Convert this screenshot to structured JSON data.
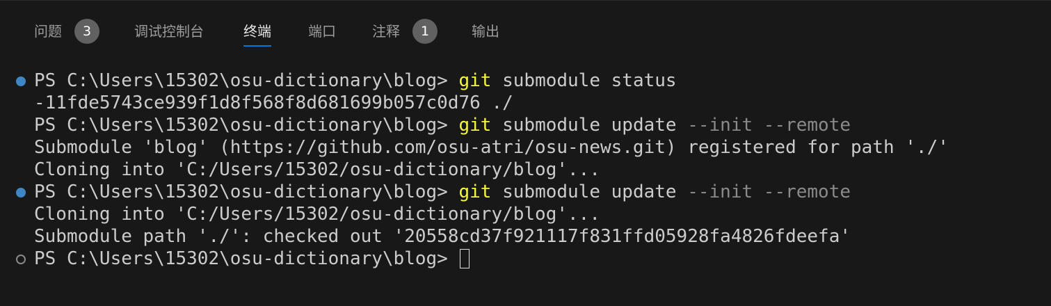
{
  "panel_tabs": [
    {
      "label": "问题",
      "badge": "3"
    },
    {
      "label": "调试控制台"
    },
    {
      "label": "终端",
      "active": true
    },
    {
      "label": "端口"
    },
    {
      "label": "注释",
      "badge": "1"
    },
    {
      "label": "输出"
    }
  ],
  "terminal": {
    "lines": [
      {
        "prompt": "PS C:\\Users\\15302\\osu-dictionary\\blog> ",
        "cmd": "git",
        "args": " submodule status",
        "flags": ""
      },
      {
        "text": "-11fde5743ce939f1d8f568f8d681699b057c0d76 ./"
      },
      {
        "prompt": "PS C:\\Users\\15302\\osu-dictionary\\blog> ",
        "cmd": "git",
        "args": " submodule update ",
        "flags": "--init --remote"
      },
      {
        "text": "Submodule 'blog' (https://github.com/osu-atri/osu-news.git) registered for path './'"
      },
      {
        "text": "Cloning into 'C:/Users/15302/osu-dictionary/blog'..."
      },
      {
        "prompt": "PS C:\\Users\\15302\\osu-dictionary\\blog> ",
        "cmd": "git",
        "args": " submodule update ",
        "flags": "--init --remote"
      },
      {
        "text": "Cloning into 'C:/Users/15302/osu-dictionary/blog'..."
      },
      {
        "text": "Submodule path './': checked out '20558cd37f921117f831ffd05928fa4826fdeefa'"
      },
      {
        "prompt": "PS C:\\Users\\15302\\osu-dictionary\\blog> "
      }
    ]
  },
  "colors": {
    "background": "#181818",
    "command": "#f5f543",
    "flag": "#8a8a8a",
    "text": "#cccccc",
    "decoration_success": "#3e87c4",
    "active_tab_underline": "#0078d4"
  }
}
